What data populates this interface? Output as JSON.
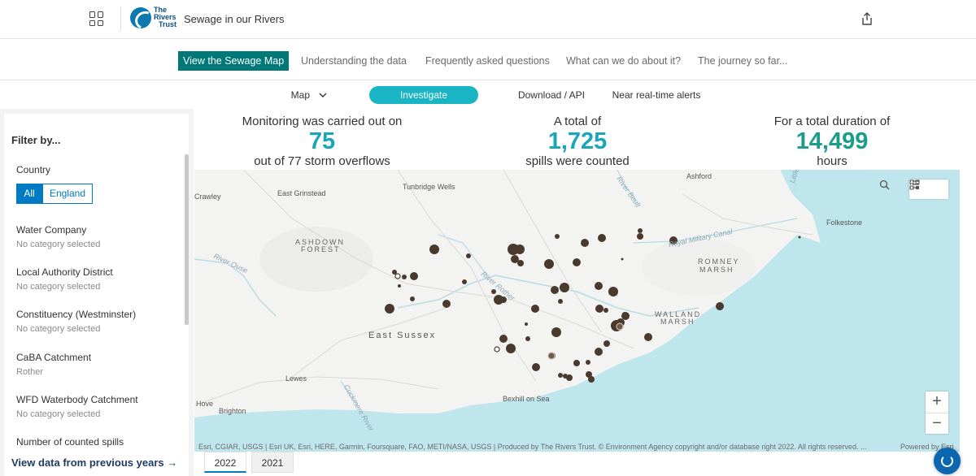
{
  "header": {
    "logo_text": [
      "The",
      "Rivers",
      "Trust"
    ],
    "title": "Sewage in our Rivers",
    "apps_icon": "apps-grid-icon",
    "share_icon": "share-icon"
  },
  "nav_primary": [
    {
      "label": "View the Sewage Map",
      "active": true
    },
    {
      "label": "Understanding the data"
    },
    {
      "label": "Frequently asked questions"
    },
    {
      "label": "What can we do about it?"
    },
    {
      "label": "The journey so far..."
    }
  ],
  "nav_secondary": [
    {
      "label": "Map"
    },
    {
      "label": "Investigate",
      "active": true
    },
    {
      "label": "Download / API"
    },
    {
      "label": "Near real-time alerts"
    }
  ],
  "filters": {
    "title": "Filter by...",
    "country": {
      "label": "Country",
      "options": [
        "All",
        "England"
      ],
      "selected": "All"
    },
    "groups": [
      {
        "label": "Water Company",
        "value": "No category selected"
      },
      {
        "label": "Local Authority District",
        "value": "No category selected"
      },
      {
        "label": "Constituency (Westminster)",
        "value": "No category selected"
      },
      {
        "label": "CaBA Catchment",
        "value": "Rother"
      },
      {
        "label": "WFD Waterbody Catchment",
        "value": "No category selected"
      },
      {
        "label": "Number of counted spills",
        "value": ""
      }
    ],
    "previous_years_link": "View data from previous years →"
  },
  "stats": [
    {
      "top": "Monitoring was carried out on",
      "value": "75",
      "bottom": "out of 77 storm overflows",
      "color": "#1aa6b8"
    },
    {
      "top": "A total of",
      "value": "1,725",
      "bottom": "spills were counted",
      "color": "#1aa6b8"
    },
    {
      "top": "For a total duration of",
      "value": "14,499",
      "bottom": "hours",
      "color": "#1a9e8a"
    }
  ],
  "map": {
    "places": [
      "Ashford",
      "Crawley",
      "East Grinstead",
      "Tunbridge Wells",
      "Folkestone",
      "Hove",
      "Brighton",
      "Lewes",
      "Bexhill on Sea",
      "Little"
    ],
    "regions": [
      "ASHDOWN",
      "FOREST",
      "ROMNEY",
      "MARSH",
      "WALLAND",
      "MARSH"
    ],
    "county": "East Sussex",
    "water_labels": [
      "River Ouse",
      "River Rother",
      "Royal Military Canal",
      "Cuckmere River",
      "River Beult"
    ],
    "attribution": "Esri, CGIAR, USGS | Esri UK, Esri, HERE, Garmin, Foursquare, FAO, METI/NASA, USGS | Produced by The Rivers Trust. © Environment Agency copyright and/or database right 2022. All rights reserved. ...",
    "powered_by": "Powered by Esri",
    "zoom_in": "+",
    "zoom_out": "−"
  },
  "years": [
    {
      "label": "2022",
      "active": true
    },
    {
      "label": "2021"
    }
  ],
  "colors": {
    "accent": "#007878",
    "pill": "#1ab5c4",
    "sea": "#bde4ea",
    "dots": "#4a3a2e"
  }
}
